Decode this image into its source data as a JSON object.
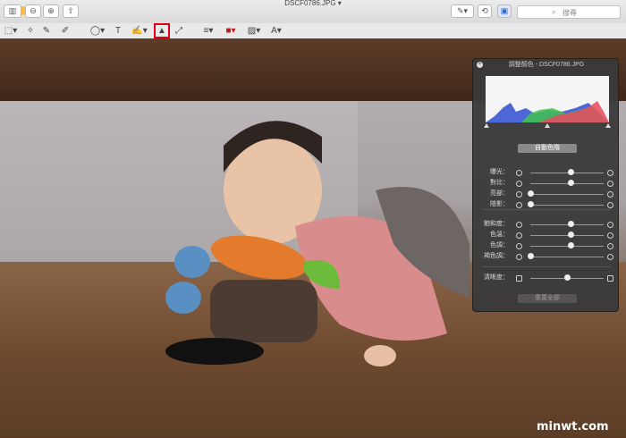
{
  "window": {
    "title": "DSCF0786.JPG ▾"
  },
  "toolbar": {
    "search_placeholder": "搜尋"
  },
  "adjust_panel": {
    "title": "調整顏色 - DSCF0786.JPG",
    "auto_levels": "自動色階",
    "rows_group1": [
      {
        "label": "曝光：",
        "value": 0.55
      },
      {
        "label": "對比：",
        "value": 0.55
      },
      {
        "label": "亮部：",
        "value": 0.0
      },
      {
        "label": "陰影：",
        "value": 0.0
      }
    ],
    "rows_group2": [
      {
        "label": "飽和度：",
        "value": 0.55
      },
      {
        "label": "色溫：",
        "value": 0.55
      },
      {
        "label": "色調：",
        "value": 0.55
      },
      {
        "label": "褐色調：",
        "value": 0.0
      }
    ],
    "sharpness": {
      "label": "清晰度：",
      "value": 0.5
    },
    "reset_all": "重置全部"
  },
  "watermark": "minwt.com",
  "colors": {
    "highlight": "#e0001a"
  }
}
